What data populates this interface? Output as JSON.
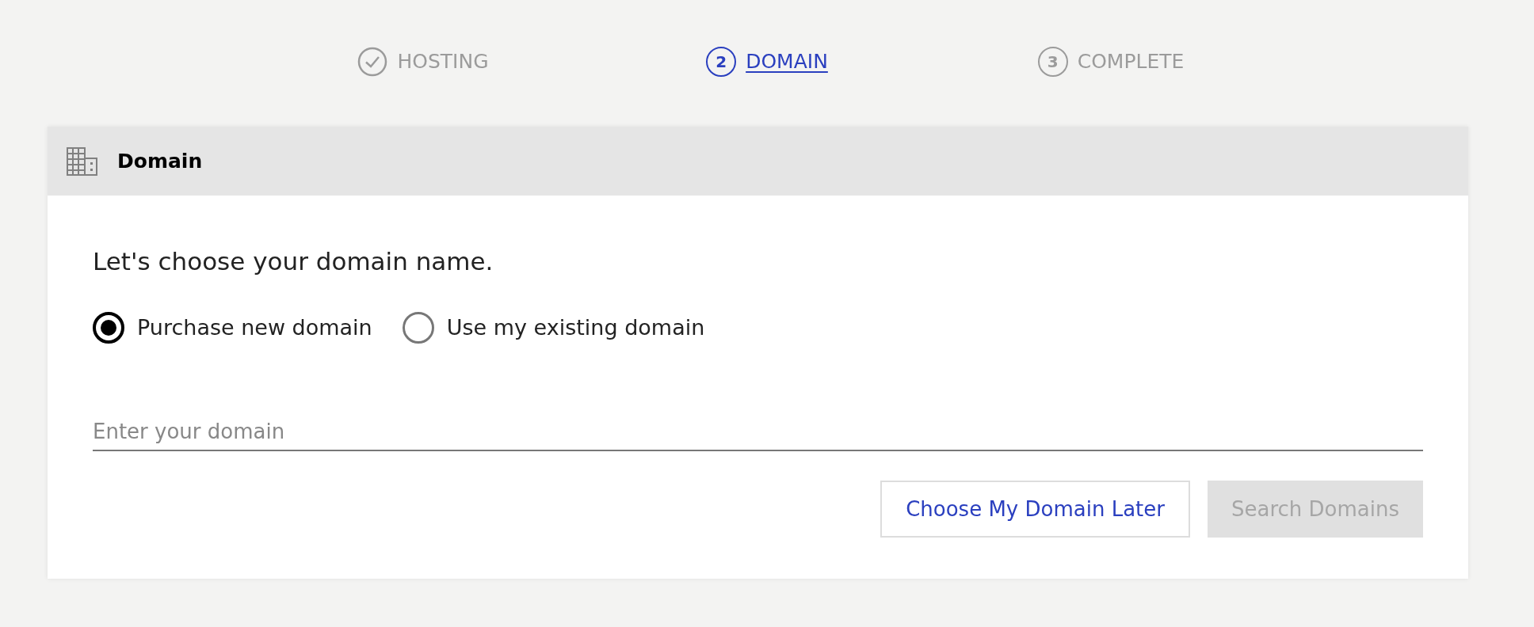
{
  "steps": [
    {
      "label": "HOSTING",
      "completed": true,
      "selected": false
    },
    {
      "label": "DOMAIN",
      "number": "2",
      "completed": false,
      "selected": true
    },
    {
      "label": "COMPLETE",
      "number": "3",
      "completed": false,
      "selected": false
    }
  ],
  "card": {
    "title": "Domain",
    "heading": "Let's choose your domain name.",
    "options": [
      {
        "label": "Purchase new domain",
        "selected": true
      },
      {
        "label": "Use my existing domain",
        "selected": false
      }
    ],
    "domain_field": {
      "placeholder": "Enter your domain"
    },
    "buttons": [
      {
        "label": "Choose My Domain Later",
        "kind": "outline",
        "disabled": false
      },
      {
        "label": "Search Domains",
        "kind": "filled",
        "disabled": true
      }
    ]
  }
}
